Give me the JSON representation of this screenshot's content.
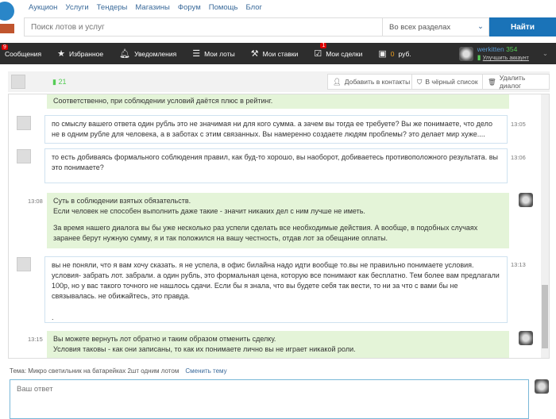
{
  "nav": [
    "Аукцион",
    "Услуги",
    "Тендеры",
    "Магазины",
    "Форум",
    "Помощь",
    "Блог"
  ],
  "search": {
    "placeholder": "Поиск лотов и услуг",
    "section": "Во всех разделах",
    "button": "Найти"
  },
  "bar": {
    "messages": "Сообщения",
    "messages_badge": "9",
    "favorites": "Избранное",
    "notifications": "Уведомления",
    "my_lots": "Мои лоты",
    "my_bids": "Мои ставки",
    "my_deals": "Мои сделки",
    "deals_badge": "1",
    "balance": "0",
    "currency": "руб.",
    "username": "werkitten",
    "rating": "354",
    "upgrade": "Улучшить аккаунт"
  },
  "dialog": {
    "rating": "21",
    "add_contact": "Добавить в контакты",
    "blacklist": "В чёрный список",
    "delete": "Удалить диалог"
  },
  "messages": [
    {
      "text": "Соответственно, при соблюдении условий даётся плюс в рейтинг."
    },
    {
      "time": "13:05",
      "text": "по смыслу вашего ответа один рубль это не значимая ни для кого сумма. а зачем вы тогда ее требуете? Вы же понимаете, что дело не в одним рубле для человека, а в заботах с этим связанных. Вы намеренно создаете людям проблемы? это делает мир хуже...."
    },
    {
      "time": "13:06",
      "text": "то есть добиваясь формального соблюдения правил, как буд-то хорошо, вы наоборот, добиваетесь противоположного результата. вы это понимаете?"
    },
    {
      "time": "13:08",
      "p1": "Суть в соблюдении взятых обязательств.",
      "p2": "Если человек не способен выполнить даже такие - значит никаких дел с ним лучше не иметь.",
      "p3": "За время нашего диалога вы бы уже несколько раз успели сделать все необходимые действия. А вообще, в подобных случаях заранее берут нужную сумму, я и так положился на вашу честность, отдав лот за обещание оплаты."
    },
    {
      "time": "13:13",
      "text": "вы не поняли, что я вам хочу сказать. я не успела, в офис билайна надо идти вообще то.вы не правильно понимаете условия. условия- забрать лот. забрали. а один рубль, это формальная цена, которую все понимают как бесплатно. Тем более вам предлагали 100р, но у вас такого точного не нашлось сдачи. Если бы я знала, что вы будете себя так вести, то ни за что с вами бы не связывалась. не обижайтесь, это правда.",
      "tail": "."
    },
    {
      "time": "13:15",
      "p1": "Вы можете вернуть лот обратно и таким образом отменить сделку.",
      "p2": "Условия таковы - как они записаны, то как их понимаете лично вы не играет никакой роли."
    }
  ],
  "topic": {
    "label": "Тема:",
    "value": "Микро светильник на батарейках 2шт одним лотом",
    "change": "Сменить тему"
  },
  "reply": {
    "placeholder": "Ваш ответ"
  }
}
